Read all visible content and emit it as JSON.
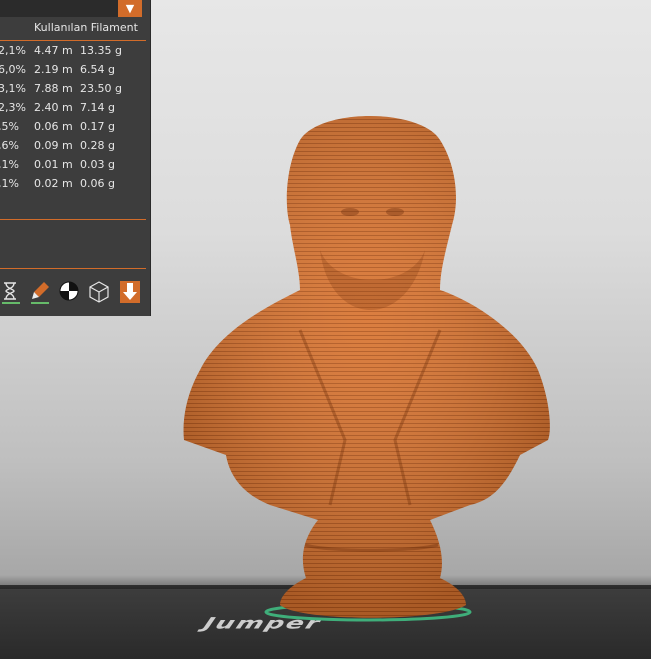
{
  "panel": {
    "dropdown_glyph": "▼",
    "column_header": "Kullanılan Filament",
    "rows": [
      {
        "percent": "2,1%",
        "length": "4.47 m",
        "weight": "13.35 g"
      },
      {
        "percent": "6,0%",
        "length": "2.19 m",
        "weight": "6.54 g"
      },
      {
        "percent": "3,1%",
        "length": "7.88 m",
        "weight": "23.50 g"
      },
      {
        "percent": "2,3%",
        "length": "2.40 m",
        "weight": "7.14 g"
      },
      {
        "percent": ",5%",
        "length": "0.06 m",
        "weight": "0.17 g"
      },
      {
        "percent": ",6%",
        "length": "0.09 m",
        "weight": "0.28 g"
      },
      {
        "percent": ",1%",
        "length": "0.01 m",
        "weight": "0.03 g"
      },
      {
        "percent": ",1%",
        "length": "0.02 m",
        "weight": "0.06 g"
      }
    ],
    "toolbar_icons": [
      "hourglass-icon",
      "paint-brush-icon",
      "half-circle-icon",
      "wireframe-cube-icon",
      "download-arrow-icon"
    ]
  },
  "colors": {
    "accent": "#d26c2a",
    "panel_bg": "#3d3d3d",
    "model_orange": "#d8732f",
    "active_underline": "#66bb6a"
  },
  "bed_logo": "Jumper"
}
